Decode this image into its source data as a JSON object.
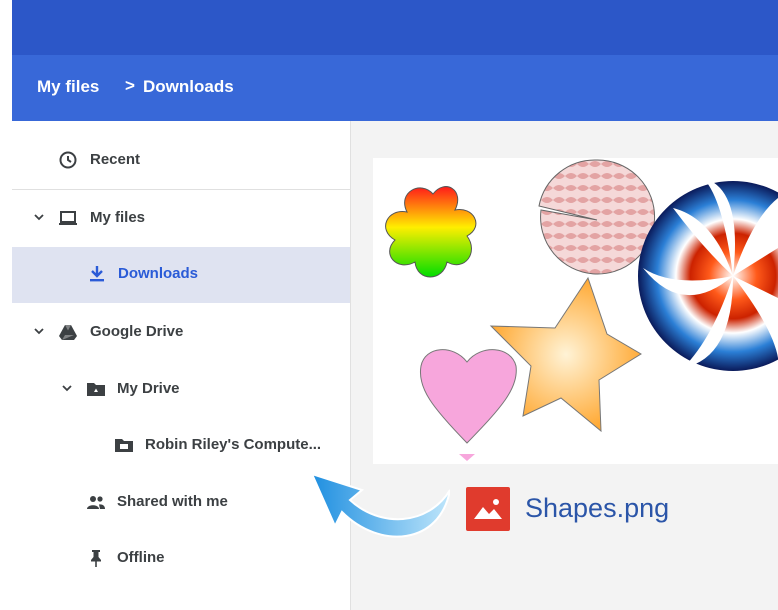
{
  "breadcrumb": {
    "root": "My files",
    "separator": ">",
    "current": "Downloads"
  },
  "sidebar": {
    "items": [
      {
        "label": "Recent",
        "icon": "clock-icon"
      },
      {
        "label": "My files",
        "icon": "laptop-icon",
        "expanded": true
      },
      {
        "label": "Downloads",
        "icon": "download-icon",
        "selected": true
      },
      {
        "label": "Google Drive",
        "icon": "drive-icon",
        "expanded": true
      },
      {
        "label": "My Drive",
        "icon": "shared-folder-icon",
        "expanded": true
      },
      {
        "label": "Robin Riley's Compute...",
        "icon": "computer-folder-icon"
      },
      {
        "label": "Shared with me",
        "icon": "people-icon"
      },
      {
        "label": "Offline",
        "icon": "pin-icon"
      }
    ]
  },
  "file": {
    "name": "Shapes.png",
    "icon": "image-file-icon"
  },
  "colors": {
    "topbar": "#2c57c8",
    "breadcrumb_bar": "#3868d8",
    "selected": "#dfe3f1",
    "accent": "#2a5bd7"
  }
}
